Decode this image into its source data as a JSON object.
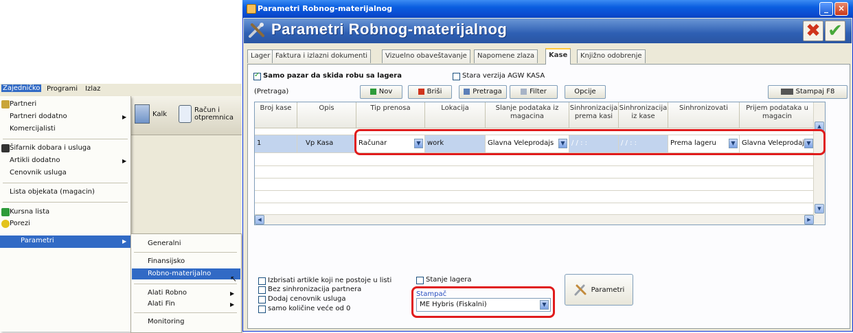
{
  "bg_app": {
    "menubar": [
      "Zajedničko",
      "Programi",
      "Izlaz"
    ],
    "toolbar": [
      {
        "label": "Kalk",
        "icon": "document-icon"
      },
      {
        "label": "Račun i otpremnica",
        "icon": "pen-document-icon"
      }
    ],
    "menu": {
      "partneri": "Partneri",
      "partneri_dodatno": "Partneri dodatno",
      "komercijalisti": "Komercijalisti",
      "sifarnik": "Šifarnik dobara i usluga",
      "artikli_dodatno": "Artikli dodatno",
      "cenovnik": "Cenovnik usluga",
      "lista_objekata": "Lista objekata (magacin)",
      "kursna_lista": "Kursna lista",
      "porezi": "Porezi",
      "parametri": "Parametri"
    },
    "submenu": {
      "generalni": "Generalni",
      "finansijsko": "Finansijsko",
      "robno": "Robno-materijalno",
      "alati_robno": "Alati Robno",
      "alati_fin": "Alati Fin",
      "monitoring": "Monitoring"
    }
  },
  "window": {
    "title": "Parametri Robnog-materijalnog",
    "banner": "Parametri Robnog-materijalnog",
    "minimize": "_",
    "close": "×",
    "cancel": "✖",
    "ok": "✔"
  },
  "tabs": [
    "Lager",
    "Faktura i izlazni dokumenti",
    "Vizuelno obaveštavanje",
    "Napomene zlaza",
    "Kase",
    "Knjižno odobrenje"
  ],
  "active_tab": "Kase",
  "options": {
    "samo_pazar": "Samo pazar da skida robu sa lagera",
    "samo_pazar_checked": true,
    "stara_verzija": "Stara verzija AGW KASA",
    "stara_verzija_checked": false
  },
  "toolbar": {
    "search_label": "(Pretraga)",
    "nov": "Nov",
    "brisi": "Briši",
    "pretraga": "Pretraga",
    "filter": "Filter",
    "opcije": "Opcije",
    "stampaj": "Stampaj F8"
  },
  "grid": {
    "columns": [
      "Broj kase",
      "Opis",
      "Tip prenosa",
      "Lokacija",
      "Slanje podataka iz magacina",
      "Sinhronizacija prema kasi",
      "Sinhronizacija iz kase",
      "Sinhronizovati",
      "Prijem podataka u magacin"
    ],
    "row": [
      "1",
      "Vp Kasa",
      "Računar",
      "work",
      "Glavna Veleprodajs",
      "/ /   : :",
      "/ /   : :",
      "Prema lageru",
      "Glavna Veleprodaja"
    ]
  },
  "bottom": {
    "izbrisati": "Izbrisati artikle koji ne postoje u listi",
    "bez_sinhronizacije": "Bez sinhronizacija partnera",
    "dodaj_cenovnik": "Dodaj cenovnik usluga",
    "samo_kolicine": "samo količine veće od 0",
    "stanje_lagera": "Stanje lagera",
    "stampac_label": "Stampač",
    "stampac_value": "ME Hybris (Fiskalni)",
    "parametri_btn": "Parametri"
  },
  "colors": {
    "title_blue": "#0a5ee0",
    "highlight_red": "#e01b1b",
    "selection_blue": "#316ac5",
    "window_bg": "#ece9d8"
  }
}
